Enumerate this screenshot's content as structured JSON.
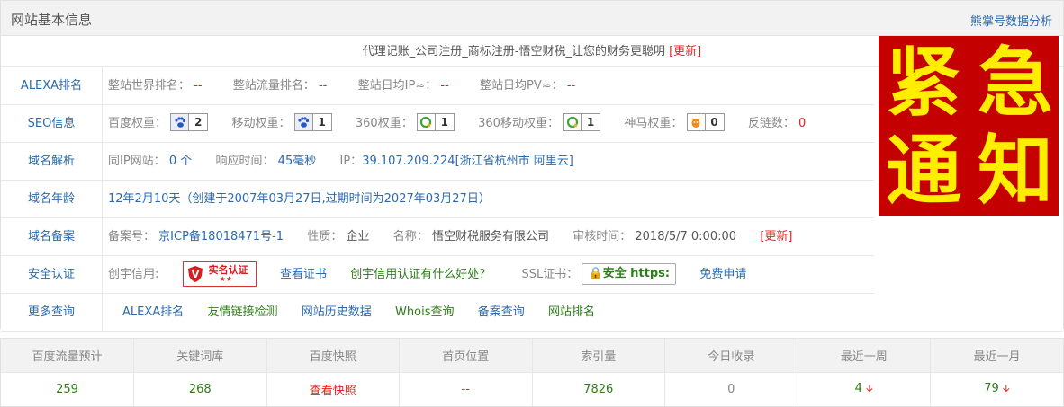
{
  "header": {
    "title": "网站基本信息",
    "link": "熊掌号数据分析"
  },
  "site": {
    "title": "代理记账_公司注册_商标注册-悟空财税_让您的财务更聪明",
    "refresh": "[更新]"
  },
  "alexa": {
    "label": "ALEXA排名",
    "world_label": "整站世界排名：",
    "world_value": "--",
    "traffic_label": "整站流量排名：",
    "traffic_value": "--",
    "ip_label": "整站日均IP≈：",
    "ip_value": "--",
    "pv_label": "整站日均PV≈：",
    "pv_value": "--"
  },
  "seo": {
    "label": "SEO信息",
    "baidu_label": "百度权重：",
    "baidu_value": "2",
    "mobile_label": "移动权重：",
    "mobile_value": "1",
    "s360_label": "360权重：",
    "s360_value": "1",
    "s360m_label": "360移动权重：",
    "s360m_value": "1",
    "shenma_label": "神马权重：",
    "shenma_value": "0",
    "backlinks_label": "反链数：",
    "backlinks_value": "0"
  },
  "dns": {
    "label": "域名解析",
    "sameip_label": "同IP网站：",
    "sameip_value": "0 个",
    "response_label": "响应时间：",
    "response_value": "45毫秒",
    "ip_label": "IP：",
    "ip_value": "39.107.209.224[浙江省杭州市 阿里云]"
  },
  "age": {
    "label": "域名年龄",
    "value": "12年2月10天（创建于2007年03月27日,过期时间为2027年03月27日）"
  },
  "icp": {
    "label": "域名备案",
    "no_label": "备案号：",
    "no_value": "京ICP备18018471号-1",
    "type_label": "性质：",
    "type_value": "企业",
    "name_label": "名称：",
    "name_value": "悟空财税服务有限公司",
    "audit_label": "审核时间：",
    "audit_value": "2018/5/7 0:00:00",
    "refresh": "[更新]"
  },
  "security": {
    "label": "安全认证",
    "credit_label": "创宇信用:",
    "badge_text": "实名认证",
    "cert_link": "查看证书",
    "benefit_link": "创宇信用认证有什么好处？",
    "ssl_label": "SSL证书：",
    "ssl_badge": "安全 https:",
    "apply_link": "免费申请"
  },
  "more": {
    "label": "更多查询",
    "links": [
      "ALEXA排名",
      "友情链接检测",
      "网站历史数据",
      "Whois查询",
      "备案查询",
      "网站排名"
    ]
  },
  "notice": {
    "chars": [
      "紧",
      "急",
      "通",
      "知"
    ],
    "bg": "#c50000",
    "fg": "#ffee00"
  },
  "stats": {
    "headers": [
      "百度流量预计",
      "关键词库",
      "百度快照",
      "首页位置",
      "索引量",
      "今日收录",
      "最近一周",
      "最近一月"
    ],
    "values": [
      "259",
      "268",
      "查看快照",
      "--",
      "7826",
      "0",
      "4",
      "79"
    ]
  }
}
